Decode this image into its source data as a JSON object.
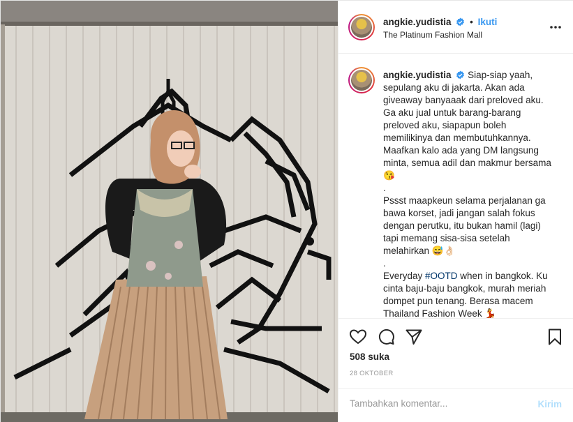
{
  "post": {
    "username": "angkie.yudistia",
    "follow_label": "Ikuti",
    "dot": "•",
    "location": "The Platinum Fashion Mall",
    "icons": {
      "verified": "verified-badge-icon",
      "more": "more-options-icon",
      "like": "heart-icon",
      "comment": "comment-icon",
      "share": "share-icon",
      "save": "bookmark-icon"
    },
    "photo_alt": "Woman in hijab and pleated pants posing in front of mural"
  },
  "caption": {
    "username": "angkie.yudistia",
    "lines": [
      "Siap-siap yaah, sepulang aku di jakarta. Akan ada giveaway banyaaak dari preloved aku. Ga aku jual untuk barang-barang preloved aku, siapapun boleh memilikinya dan membutuhkannya. Maafkan kalo ada yang DM langsung minta, semua adil dan makmur bersama 😘",
      ".",
      "Pssst maapkeun selama perjalanan ga bawa korset, jadi jangan salah fokus dengan perutku, itu bukan hamil (lagi) tapi memang sisa-sisa setelah melahirkan 😅👌🏻",
      "."
    ],
    "last_prefix": "Everyday ",
    "hashtag": "#OOTD",
    "last_suffix": " when in bangkok. Ku cinta baju-baju bangkok, murah meriah dompet pun tenang. Berasa macem Thailand Fashion Week 💃"
  },
  "stats": {
    "likes": "508 suka",
    "date": "28 OKTOBER"
  },
  "comment": {
    "placeholder": "Tambahkan komentar...",
    "send_label": "Kirim"
  },
  "colors": {
    "link_blue": "#3897f0",
    "send_disabled": "#b2dffc",
    "verified": "#3897f0",
    "hashtag": "#003569"
  }
}
